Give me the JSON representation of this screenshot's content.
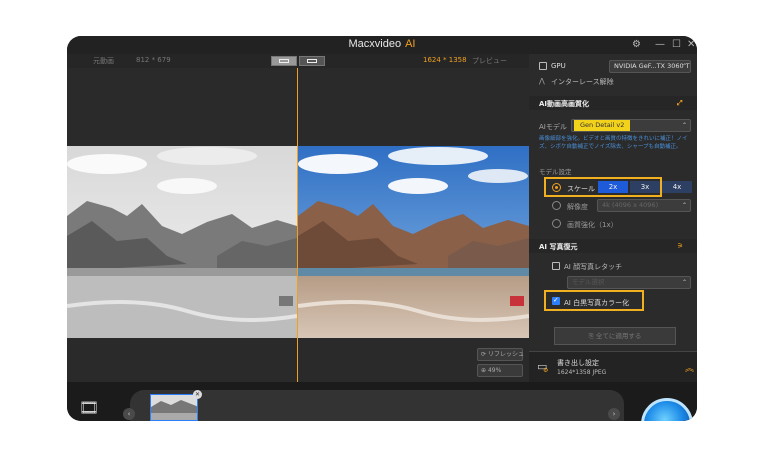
{
  "window": {
    "title_main": "Macxvideo",
    "title_ai": "AI",
    "controls": {
      "settings_icon": "gear-icon",
      "minimize": "—",
      "maximize": "☐",
      "close": "✕"
    }
  },
  "preview": {
    "original_label": "元動画",
    "original_dims": "812 * 679",
    "result_dims": "1624 * 1358",
    "preview_label": "プレビュー",
    "refresh_label": "リフレッシュ",
    "zoom_label": "49%"
  },
  "panel": {
    "gpu": {
      "label": "GPU",
      "checked": false,
      "device": "NVIDIA GeF...TX 3060 T"
    },
    "deinterlace_label": "インターレース解除",
    "section_enhance": {
      "title": "AI動画高画質化",
      "model_label": "AIモデル",
      "model_value": "Gen Detail v2",
      "description": "画像細部を強化。ビデオと画質の特徴をきれいに補正！ノイズ、シボケ自動補正でノイズ除去、シャープも自動補正。",
      "model_settings_label": "モデル設定",
      "scale_label": "スケール",
      "scale_options": [
        "2x",
        "3x",
        "4x"
      ],
      "resolution_label": "解像度",
      "resolution_value": "4k (4096 x 4096)",
      "enhance_label": "画質強化（1x）"
    },
    "section_restore": {
      "title": "AI 写真復元",
      "face_label": "AI 顔写真レタッチ",
      "face_checked": false,
      "face_option": "モデル選択",
      "colorize_label": "AI 白黒写真カラー化",
      "colorize_checked": true
    },
    "apply_all_label": "全てに適用する",
    "export": {
      "title": "書き出し設定",
      "value": "1624*1358  JPEG"
    }
  },
  "colors": {
    "accent": "#f0a020",
    "highlight": "#f2d21a",
    "blue": "#2d7ff9"
  }
}
